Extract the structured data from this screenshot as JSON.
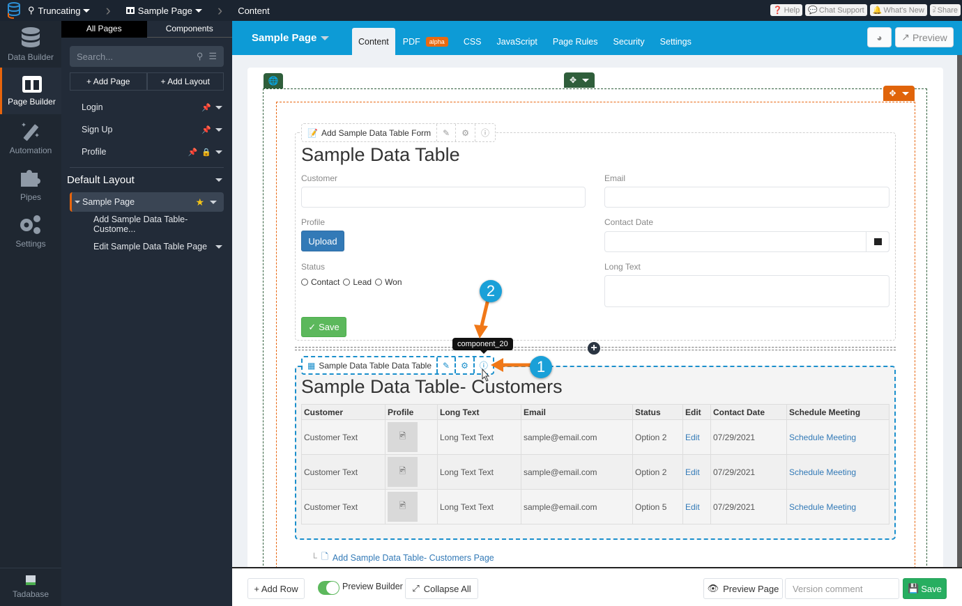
{
  "topbar": {
    "crumbs": [
      {
        "label": "Truncating",
        "icon": "search-icon"
      },
      {
        "label": "Sample Page",
        "icon": "columns-icon"
      },
      {
        "label": "Content"
      }
    ],
    "buttons": [
      {
        "label": "Help",
        "icon": "question-icon"
      },
      {
        "label": "Chat Support",
        "icon": "comments-icon"
      },
      {
        "label": "What's New",
        "icon": "bell-icon"
      },
      {
        "label": "Share",
        "icon": "share-icon"
      }
    ]
  },
  "leftnav": {
    "items": [
      {
        "label": "Data Builder",
        "icon": "database-icon"
      },
      {
        "label": "Page Builder",
        "icon": "columns-icon",
        "active": true
      },
      {
        "label": "Automation",
        "icon": "magic-wand-icon"
      },
      {
        "label": "Pipes",
        "icon": "puzzle-icon"
      },
      {
        "label": "Settings",
        "icon": "gears-icon"
      }
    ],
    "footer": "Tadabase"
  },
  "pages_panel": {
    "tabs": [
      "All Pages",
      "Components"
    ],
    "search_placeholder": "Search...",
    "add_page": "+ Add Page",
    "add_layout": "+ Add Layout",
    "pages": [
      {
        "label": "Login",
        "pinned": true,
        "locked": false
      },
      {
        "label": "Sign Up",
        "pinned": true,
        "locked": false
      },
      {
        "label": "Profile",
        "pinned": true,
        "locked": true
      }
    ],
    "layout_title": "Default Layout",
    "selected_page": "Sample Page",
    "subpages": [
      "Add Sample Data Table- Custome...",
      "Edit Sample Data Table Page"
    ]
  },
  "header": {
    "page_title": "Sample Page",
    "tabs": [
      "Content",
      "PDF",
      "CSS",
      "JavaScript",
      "Page Rules",
      "Security",
      "Settings"
    ],
    "active_tab": "Content",
    "pdf_badge": "alpha",
    "preview_label": "Preview"
  },
  "form_component": {
    "toolbar_label": "Add Sample Data Table Form",
    "title": "Sample Data Table",
    "fields": {
      "customer": "Customer",
      "email": "Email",
      "profile": "Profile",
      "contact_date": "Contact Date",
      "status": "Status",
      "long_text": "Long Text"
    },
    "upload_label": "Upload",
    "status_options": [
      "Contact",
      "Lead",
      "Won"
    ],
    "save_label": "Save"
  },
  "table_component": {
    "toolbar_label": "Sample Data Table Data Table",
    "tooltip": "component_20",
    "title": "Sample Data Table- Customers",
    "columns": [
      "Customer",
      "Profile",
      "Long Text",
      "Email",
      "Status",
      "Edit",
      "Contact Date",
      "Schedule Meeting"
    ],
    "rows": [
      {
        "customer": "Customer Text",
        "long_text": "Long Text Text",
        "email": "sample@email.com",
        "status": "Option 2",
        "edit": "Edit",
        "date": "07/29/2021",
        "meeting": "Schedule Meeting"
      },
      {
        "customer": "Customer Text",
        "long_text": "Long Text Text",
        "email": "sample@email.com",
        "status": "Option 2",
        "edit": "Edit",
        "date": "07/29/2021",
        "meeting": "Schedule Meeting"
      },
      {
        "customer": "Customer Text",
        "long_text": "Long Text Text",
        "email": "sample@email.com",
        "status": "Option 5",
        "edit": "Edit",
        "date": "07/29/2021",
        "meeting": "Schedule Meeting"
      }
    ],
    "child_page_link": "Add Sample Data Table- Customers Page"
  },
  "annotations": {
    "marker1": "1",
    "marker2": "2"
  },
  "bottombar": {
    "add_row": "+ Add Row",
    "preview_builder": "Preview Builder",
    "preview_builder_on": true,
    "collapse_all": "Collapse All",
    "preview_page": "Preview Page",
    "version_placeholder": "Version comment",
    "save": "Save"
  },
  "colors": {
    "accent_blue": "#0d9bd6",
    "accent_orange": "#e8650d",
    "section_green": "#2f5e3b",
    "save_green": "#27ae60"
  }
}
